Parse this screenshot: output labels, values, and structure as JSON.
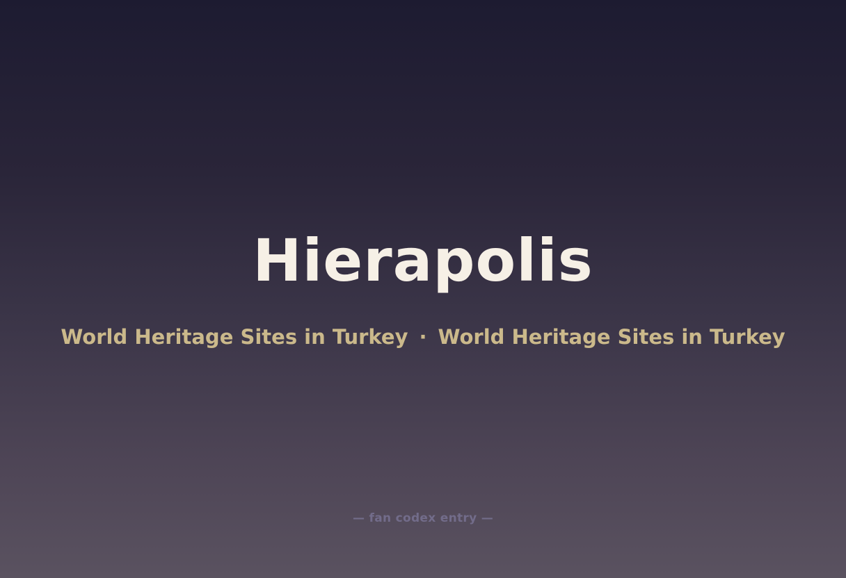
{
  "page": {
    "title": "Hierapolis",
    "subtitle_parts": [
      "World Heritage Sites in Turkey",
      "·",
      "World Heritage Sites in Turkey"
    ],
    "footer": "— fan codex entry —"
  },
  "colors": {
    "background_top": "#1d1b31",
    "background_bottom": "#5a5260",
    "title": "#f6f0e6",
    "subtitle": "#cbb98b",
    "footer": "#726c8a"
  }
}
